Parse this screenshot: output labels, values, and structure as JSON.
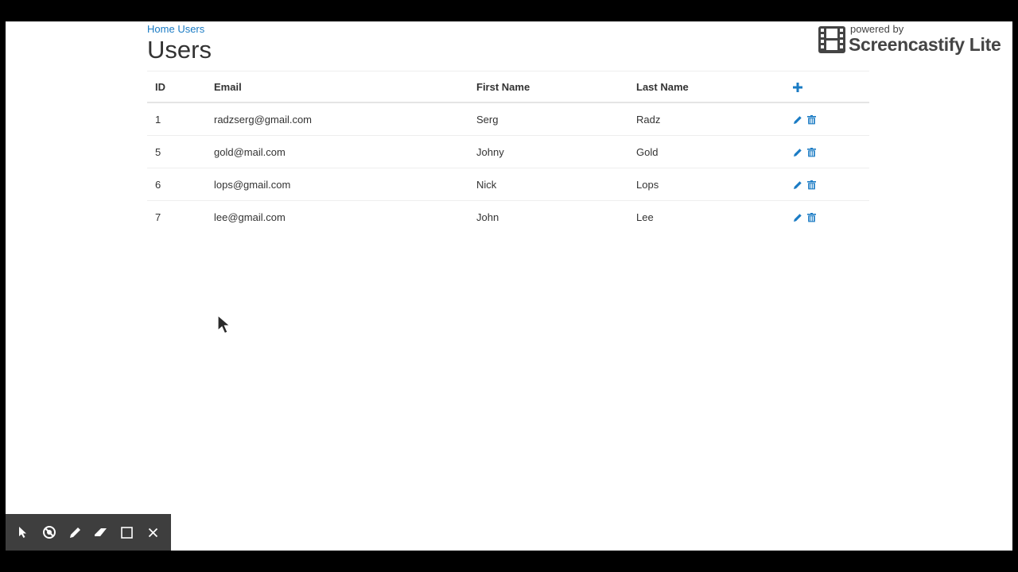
{
  "breadcrumb": {
    "home": "Home",
    "current": "Users"
  },
  "page": {
    "title": "Users"
  },
  "table": {
    "headers": {
      "id": "ID",
      "email": "Email",
      "first_name": "First Name",
      "last_name": "Last Name",
      "add_icon": "plus-icon"
    },
    "rows": [
      {
        "id": "1",
        "email": "radzserg@gmail.com",
        "first_name": "Serg",
        "last_name": "Radz"
      },
      {
        "id": "5",
        "email": "gold@mail.com",
        "first_name": "Johny",
        "last_name": "Gold"
      },
      {
        "id": "6",
        "email": "lops@gmail.com",
        "first_name": "Nick",
        "last_name": "Lops"
      },
      {
        "id": "7",
        "email": "lee@gmail.com",
        "first_name": "John",
        "last_name": "Lee"
      }
    ],
    "row_action_icons": [
      "pencil-icon",
      "trash-icon"
    ]
  },
  "watermark": {
    "powered_by": "powered by",
    "brand": "Screencastify Lite"
  },
  "toolbar": {
    "tools": [
      "pointer-icon",
      "spotlight-icon",
      "pen-icon",
      "eraser-icon",
      "square-icon",
      "close-icon"
    ]
  },
  "colors": {
    "link": "#1a7bc4",
    "text": "#333333",
    "toolbar_bg": "#3e3e3e",
    "frame_bg": "#000000"
  }
}
